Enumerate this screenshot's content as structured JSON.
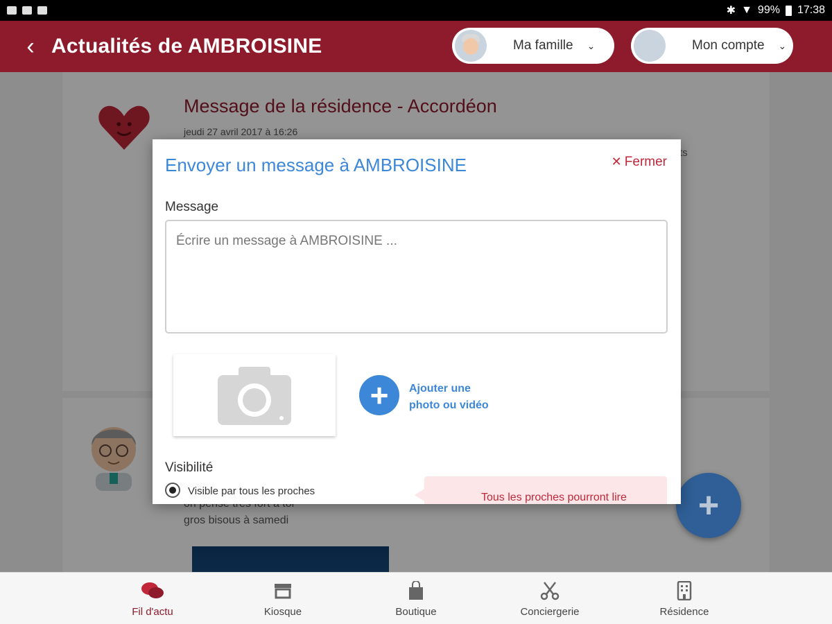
{
  "status_bar": {
    "battery": "99%",
    "time": "17:38"
  },
  "app_bar": {
    "title": "Actualités de AMBROISINE",
    "family_label": "Ma famille",
    "account_label": "Mon compte",
    "accent_color": "#8e1b2b"
  },
  "feed": {
    "post1_title": "Message de la résidence - Accordéon",
    "post1_date": "jeudi 27 avril 2017 à 16:26",
    "post1_trailing": "ts",
    "post2_line1": "on pense très fort à toi",
    "post2_line2": "gros bisous à samedi"
  },
  "modal": {
    "title": "Envoyer un message à AMBROISINE",
    "close_label": "Fermer",
    "message_label": "Message",
    "message_placeholder": "Écrire un message à AMBROISINE ...",
    "add_media_line1": "Ajouter une",
    "add_media_line2": "photo ou vidéo",
    "visibility_label": "Visibilité",
    "visibility_option": "Visible par tous les proches",
    "visibility_hint": "Tous les proches pourront lire",
    "link_color": "#3d87d8"
  },
  "bottom_nav": {
    "items": [
      {
        "label": "Fil d'actu",
        "icon": "chat-bubbles-icon",
        "active": true
      },
      {
        "label": "Kiosque",
        "icon": "store-icon",
        "active": false
      },
      {
        "label": "Boutique",
        "icon": "shopping-bag-icon",
        "active": false
      },
      {
        "label": "Conciergerie",
        "icon": "scissors-icon",
        "active": false
      },
      {
        "label": "Résidence",
        "icon": "building-icon",
        "active": false
      }
    ]
  }
}
